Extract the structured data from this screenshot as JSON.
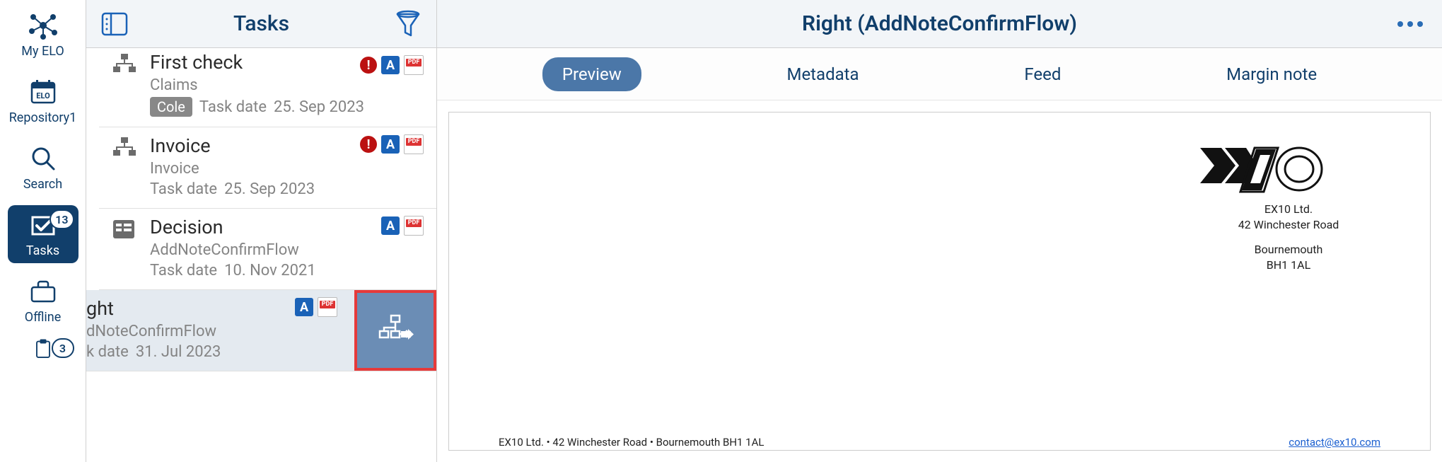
{
  "left_nav": {
    "items": [
      {
        "label": "My ELO"
      },
      {
        "label": "Repository1"
      },
      {
        "label": "Search"
      },
      {
        "label": "Tasks",
        "badge": "13"
      },
      {
        "label": "Offline"
      }
    ],
    "partial_badge": "3"
  },
  "task_panel": {
    "title": "Tasks"
  },
  "tasks": [
    {
      "title": "First check",
      "sub": "Claims",
      "assignee": "Cole",
      "date_label": "Task date",
      "date": "25. Sep 2023",
      "alert": true
    },
    {
      "title": "Invoice",
      "sub": "Invoice",
      "date_label": "Task date",
      "date": "25. Sep 2023",
      "alert": true
    },
    {
      "title": "Decision",
      "sub": "AddNoteConfirmFlow",
      "date_label": "Task date",
      "date": "10. Nov 2021",
      "alert": false
    },
    {
      "title_fragment": "ght",
      "sub_fragment": "dNoteConfirmFlow",
      "date_label_fragment": "k date",
      "date": "31. Jul 2023"
    }
  ],
  "main": {
    "title": "Right (AddNoteConfirmFlow)",
    "tabs": [
      "Preview",
      "Metadata",
      "Feed",
      "Margin note"
    ],
    "active_tab": 0
  },
  "doc": {
    "company": "EX10 Ltd.",
    "street": "42 Winchester Road",
    "city": "Bournemouth",
    "postcode": "BH1 1AL",
    "footer_left": "EX10 Ltd. • 42 Winchester Road • Bournemouth BH1 1AL",
    "footer_right": "contact@ex10.com"
  }
}
